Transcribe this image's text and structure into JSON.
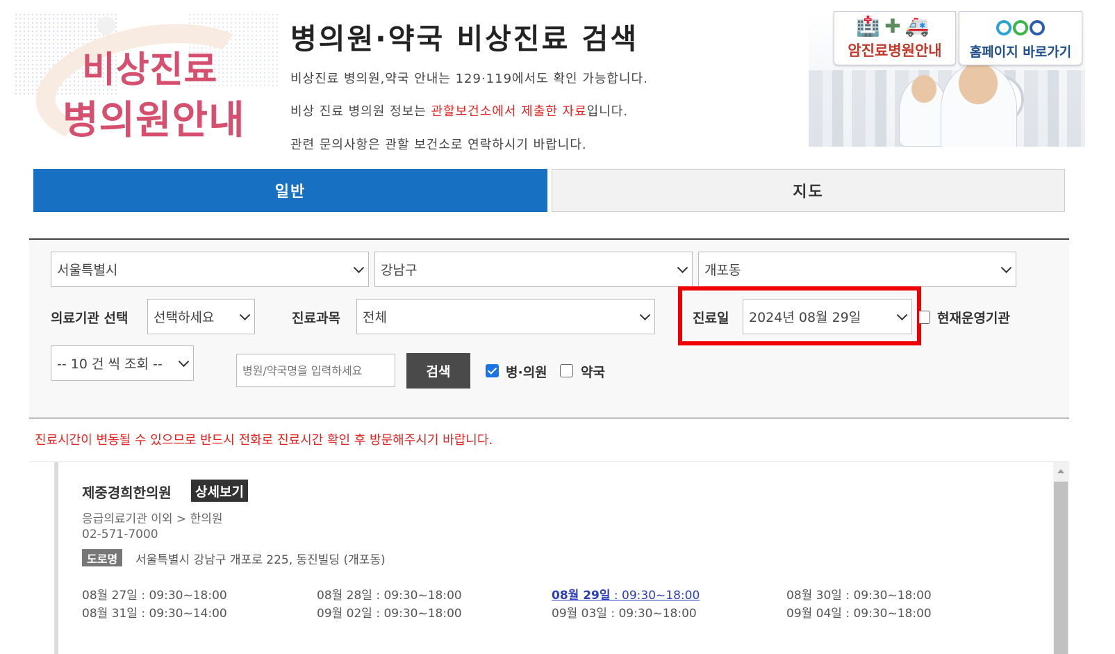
{
  "header": {
    "logo_line1": "비상진료",
    "logo_line2": "병의원안내",
    "title": "병의원·약국 비상진료 검색",
    "info_line1": "비상진료 병의원,약국 안내는 129·119에서도 확인 가능합니다.",
    "info_line2_pre": "비상 진료 병의원 정보는 ",
    "info_line2_highlight": "관할보건소에서 제출한 자료",
    "info_line2_post": "입니다.",
    "info_line3": "관련 문의사항은 관할 보건소로 연락하시기 바랍니다."
  },
  "banner": {
    "cancer_hospital_label": "암진료병원안내",
    "homepage_label": "홈페이지 바로가기"
  },
  "tabs": {
    "general": "일반",
    "map": "지도"
  },
  "filters": {
    "city": "서울특별시",
    "district": "강남구",
    "dong": "개포동",
    "institution_label": "의료기관 선택",
    "institution_value": "선택하세요",
    "department_label": "진료과목",
    "department_value": "전체",
    "date_label": "진료일",
    "date_value": "2024년 08월 29일",
    "current_operating_label": "현재운영기관",
    "page_size": "-- 10 건 씩 조회 --",
    "search_placeholder": "병원/약국명을 입력하세요",
    "search_button": "검색",
    "hospital_checkbox_label": "병·의원",
    "pharmacy_checkbox_label": "약국"
  },
  "notice": "진료시간이 변동될 수 있으므로 반드시 전화로 진료시간 확인 후 방문해주시기 바랍니다.",
  "result": {
    "name": "제중경희한의원",
    "detail_button": "상세보기",
    "category": "응급의료기관 이외 > 한의원",
    "phone": "02-571-7000",
    "road_badge": "도로명",
    "address": "서울특별시 강남구 개포로 225, 동진빌딩 (개포동)",
    "hours": [
      {
        "date": "08월 27일",
        "time": " : 09:30~18:00"
      },
      {
        "date": "08월 28일",
        "time": " : 09:30~18:00"
      },
      {
        "date": "08월 29일",
        "time": " : 09:30~18:00"
      },
      {
        "date": "08월 30일",
        "time": " : 09:30~18:00"
      },
      {
        "date": "08월 31일",
        "time": " : 09:30~14:00"
      },
      {
        "date": "09월 02일",
        "time": " : 09:30~18:00"
      },
      {
        "date": "09월 03일",
        "time": " : 09:30~18:00"
      },
      {
        "date": "09월 04일",
        "time": " : 09:30~18:00"
      }
    ]
  },
  "colors": {
    "tab_active": "#1870c2",
    "logo_pink": "#d64f6e",
    "notice_red": "#e52222",
    "highlight_box": "#ee0000",
    "today_link": "#2a3dbb"
  }
}
